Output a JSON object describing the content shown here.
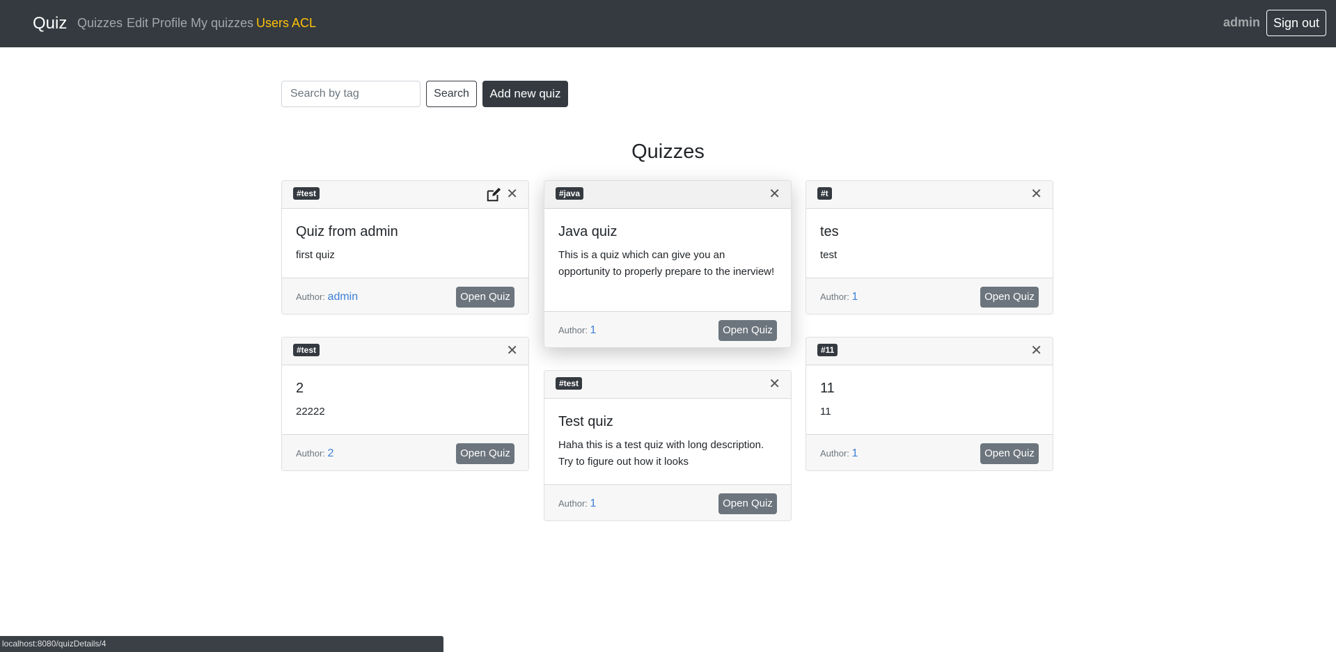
{
  "navbar": {
    "brand": "Quiz",
    "links": [
      "Quizzes",
      "Edit Profile",
      "My quizzes",
      "Users ACL"
    ],
    "user": "admin",
    "signout": "Sign out",
    "active_color": "#ffc107"
  },
  "toolbar": {
    "search_placeholder": "Search by tag",
    "search_label": "Search",
    "add_label": "Add new quiz"
  },
  "page_title": "Quizzes",
  "cards": [
    {
      "tag": "#test",
      "title": "Quiz from admin",
      "description": "first quiz",
      "author_label": "Author:",
      "author": "admin",
      "button": "Open Quiz",
      "editable": true
    },
    {
      "tag": "#java",
      "title": "Java quiz",
      "description": "This is a quiz which can give you an opportunity to properly prepare to the inerview!",
      "author_label": "Author:",
      "author": "1",
      "button": "Open Quiz",
      "editable": false
    },
    {
      "tag": "#t",
      "title": "tes",
      "description": "test",
      "author_label": "Author:",
      "author": "1",
      "button": "Open Quiz",
      "editable": false
    },
    {
      "tag": "#test",
      "title": "2",
      "description": "22222",
      "author_label": "Author:",
      "author": "2",
      "button": "Open Quiz",
      "editable": false
    },
    {
      "tag": "#test",
      "title": "Test quiz",
      "description": "Haha this is a test quiz with long description. Try to figure out how it looks",
      "author_label": "Author:",
      "author": "1",
      "button": "Open Quiz",
      "editable": false
    },
    {
      "tag": "#11",
      "title": "11",
      "description": "11",
      "author_label": "Author:",
      "author": "1",
      "button": "Open Quiz",
      "editable": false
    }
  ],
  "statusbar": {
    "url": "localhost:8080/quizDetails/4"
  },
  "icons": {
    "close": "close-icon",
    "edit": "edit-icon"
  }
}
